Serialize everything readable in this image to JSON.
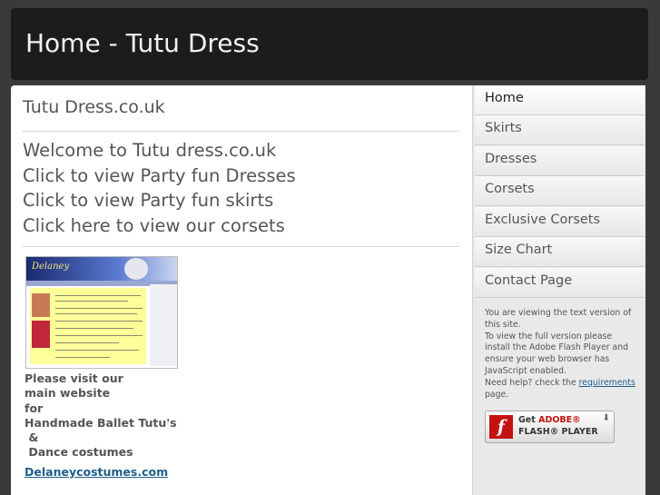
{
  "header": {
    "title": "Home - Tutu Dress"
  },
  "main": {
    "site_title": "Tutu Dress.co.uk",
    "links": [
      "Welcome to Tutu dress.co.uk",
      "Click to view Party fun Dresses",
      "Click to view Party fun skirts",
      "Click here to view our corsets"
    ],
    "thumbnail": {
      "logo_text": "Delaney"
    },
    "visit_lines": [
      "Please visit our",
      "main website",
      "for",
      "Handmade Ballet Tutu's",
      " &",
      " Dance costumes"
    ],
    "visit_link": "Delaneycostumes.com"
  },
  "sidebar": {
    "menu": [
      {
        "label": "Home"
      },
      {
        "label": "Skirts"
      },
      {
        "label": "Dresses"
      },
      {
        "label": "Corsets"
      },
      {
        "label": "Exclusive Corsets"
      },
      {
        "label": "Size Chart"
      },
      {
        "label": "Contact Page"
      }
    ],
    "notice": {
      "line1": "You are viewing the text version of this site.",
      "line2": "To view the full version please install the Adobe Flash Player and ensure your web browser has JavaScript enabled.",
      "line3_prefix": "Need help? check the ",
      "line3_link": "requirements",
      "line3_suffix": " page."
    },
    "flash_badge": {
      "icon_glyph": "f",
      "get": "Get ",
      "brand": "ADOBE®",
      "product": "FLASH® PLAYER",
      "arrow": "⬇"
    }
  },
  "colors": {
    "header_bg": "#1c1c1c",
    "page_bg": "#3a3a3a",
    "link": "#1e5e8c",
    "flash_red": "#c41212"
  }
}
